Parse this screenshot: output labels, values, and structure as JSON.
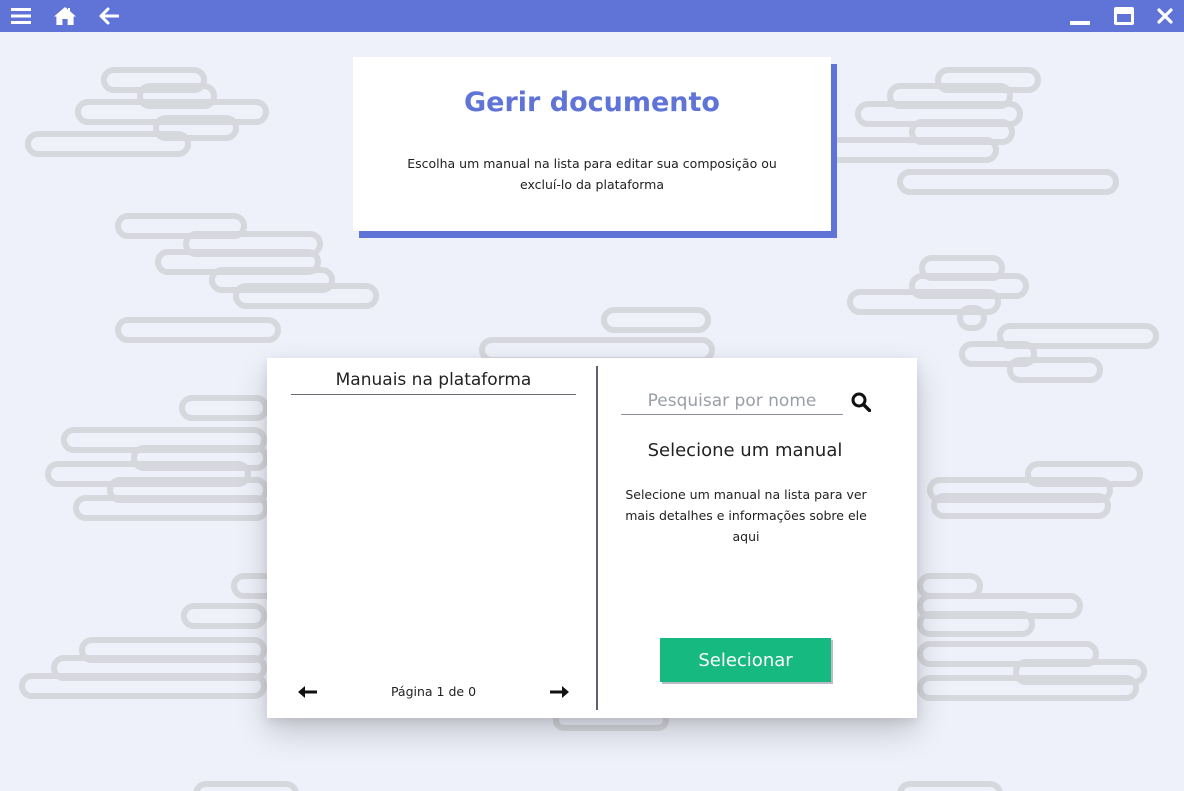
{
  "colors": {
    "accent": "#5f74d6",
    "background": "#eef0fa",
    "success": "#16b980"
  },
  "topbar": {
    "icons": [
      "menu-icon",
      "home-icon",
      "back-arrow-icon",
      "minimize-icon",
      "maximize-icon",
      "close-icon"
    ]
  },
  "header": {
    "title": "Gerir documento",
    "description": "Escolha um manual na lista para editar sua composição ou excluí-lo da plataforma"
  },
  "list": {
    "title": "Manuais na plataforma",
    "items": [],
    "pagination": {
      "label": "Página 1 de 0",
      "prev_icon": "arrow-left-icon",
      "next_icon": "arrow-right-icon"
    }
  },
  "search": {
    "placeholder": "Pesquisar por nome",
    "value": "",
    "icon": "search-icon"
  },
  "details": {
    "title": "Selecione um manual",
    "description": "Selecione um manual na lista para ver mais detalhes e informações sobre ele aqui"
  },
  "actions": {
    "select_label": "Selecionar"
  }
}
